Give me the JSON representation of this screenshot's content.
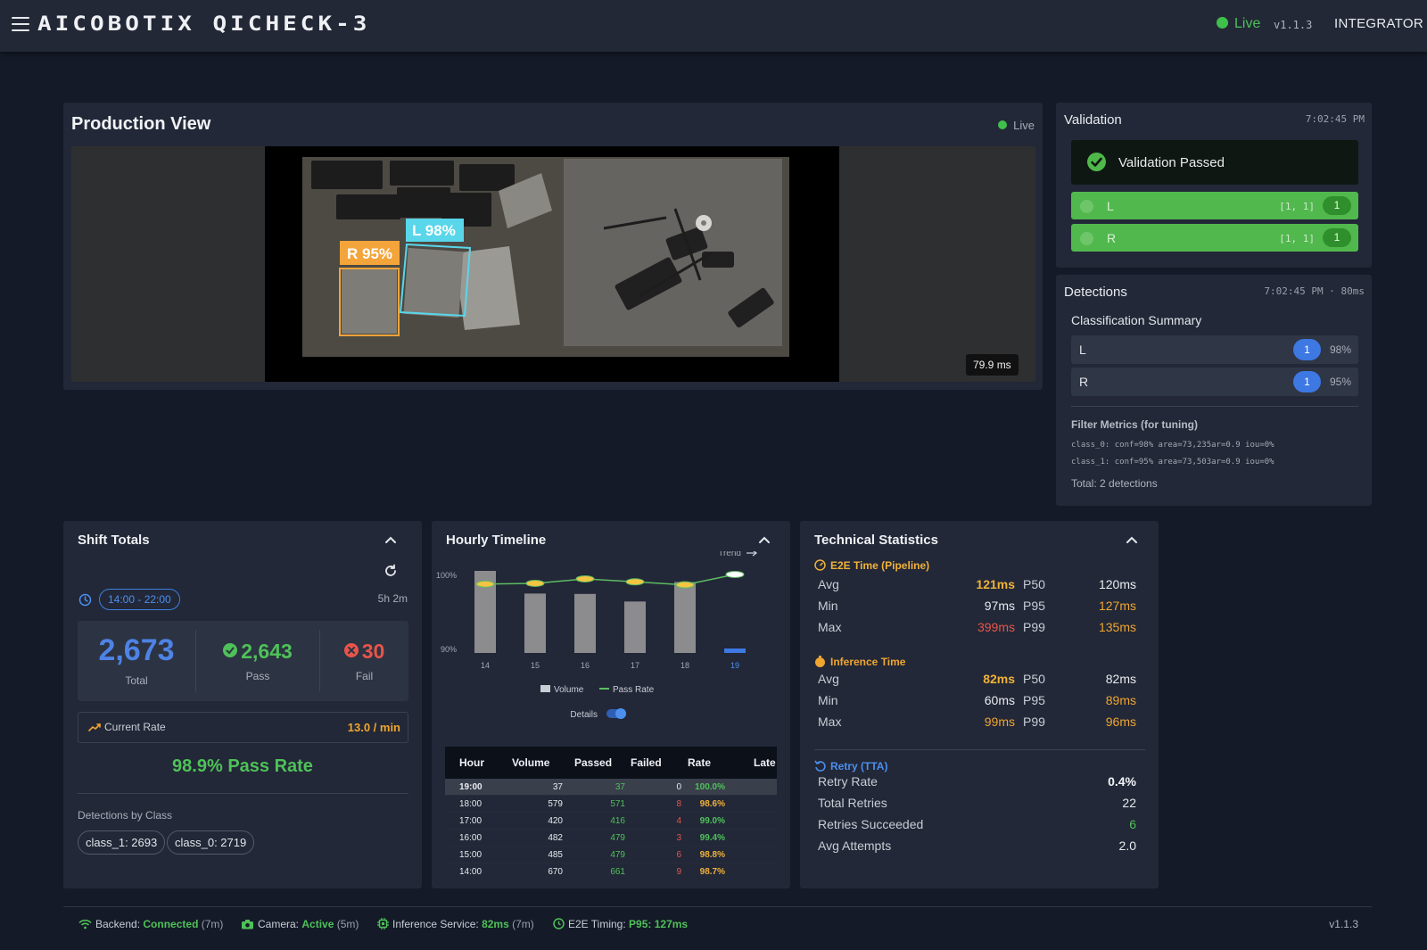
{
  "header": {
    "brand": "AICOBOTIX QICHECK-3",
    "status": "Live",
    "version": "v1.1.3",
    "role": "INTEGRATOR"
  },
  "production": {
    "title": "Production View",
    "live_label": "Live",
    "latency": "79.9 ms",
    "boxes": [
      {
        "label": "R 95%",
        "color": "#f3a43a"
      },
      {
        "label": "L 98%",
        "color": "#59d6ea"
      }
    ]
  },
  "validation": {
    "title": "Validation",
    "time": "7:02:45 PM",
    "status": "Validation Passed",
    "rows": [
      {
        "label": "L",
        "coords": "[1, 1]",
        "count": "1"
      },
      {
        "label": "R",
        "coords": "[1, 1]",
        "count": "1"
      }
    ]
  },
  "detections": {
    "title": "Detections",
    "time": "7:02:45 PM · 80ms",
    "summary_title": "Classification Summary",
    "classes": [
      {
        "label": "L",
        "count": "1",
        "pct": "98%"
      },
      {
        "label": "R",
        "count": "1",
        "pct": "95%"
      }
    ],
    "filter_title": "Filter Metrics (for tuning)",
    "filter_lines": [
      "class_0: conf=98% area=73,235ar=0.9 iou=0%",
      "class_1: conf=95% area=73,503ar=0.9 iou=0%"
    ],
    "total": "Total: 2 detections"
  },
  "shift": {
    "title": "Shift Totals",
    "range": "14:00 - 22:00",
    "duration": "5h 2m",
    "total": "2,673",
    "total_label": "Total",
    "pass": "2,643",
    "pass_label": "Pass",
    "fail": "30",
    "fail_label": "Fail",
    "rate_label": "Current Rate",
    "rate_value": "13.0 / min",
    "pass_rate": "98.9% Pass Rate",
    "by_class_label": "Detections by Class",
    "chips": [
      "class_1: 2693",
      "class_0: 2719"
    ]
  },
  "hourly": {
    "title": "Hourly Timeline",
    "trend_label": "Trend",
    "legend_volume": "Volume",
    "legend_passrate": "Pass Rate",
    "details_label": "Details",
    "details_on": true,
    "columns": [
      "Hour",
      "Volume",
      "Passed",
      "Failed",
      "Rate",
      "Late"
    ],
    "rows": [
      {
        "hour": "19:00",
        "volume": "37",
        "passed": "37",
        "failed": "0",
        "rate": "100.0%"
      },
      {
        "hour": "18:00",
        "volume": "579",
        "passed": "571",
        "failed": "8",
        "rate": "98.6%"
      },
      {
        "hour": "17:00",
        "volume": "420",
        "passed": "416",
        "failed": "4",
        "rate": "99.0%"
      },
      {
        "hour": "16:00",
        "volume": "482",
        "passed": "479",
        "failed": "3",
        "rate": "99.4%"
      },
      {
        "hour": "15:00",
        "volume": "485",
        "passed": "479",
        "failed": "6",
        "rate": "98.8%"
      },
      {
        "hour": "14:00",
        "volume": "670",
        "passed": "661",
        "failed": "9",
        "rate": "98.7%"
      }
    ]
  },
  "chart_data": {
    "type": "bar",
    "categories": [
      "14",
      "15",
      "16",
      "17",
      "18",
      "19"
    ],
    "highlight_category": "19",
    "series": [
      {
        "name": "Volume",
        "values": [
          670,
          485,
          482,
          420,
          579,
          37
        ]
      },
      {
        "name": "Pass Rate",
        "values": [
          98.7,
          98.8,
          99.4,
          99.0,
          98.6,
          100.0
        ]
      }
    ],
    "y_ticks": [
      "100%",
      "90%"
    ],
    "ylim": [
      90,
      100
    ],
    "legend": "bottom",
    "colors": {
      "volume": "#8c8c8f",
      "pass_rate": "#5dbb63",
      "marker": "#f2c542",
      "current": "#3d78e3"
    }
  },
  "tech": {
    "title": "Technical Statistics",
    "e2e_title": "E2E Time (Pipeline)",
    "e2e": [
      {
        "k": "Avg",
        "v": "121ms",
        "p": "P50",
        "pv": "120ms",
        "vc": "#f0b13a",
        "pc": "#e9ebef",
        "bold": true
      },
      {
        "k": "Min",
        "v": "97ms",
        "p": "P95",
        "pv": "127ms",
        "vc": "#e9ebef",
        "pc": "#f0a531",
        "bold": false
      },
      {
        "k": "Max",
        "v": "399ms",
        "p": "P99",
        "pv": "135ms",
        "vc": "#e8544a",
        "pc": "#f0a531",
        "bold": false
      }
    ],
    "inf_title": "Inference Time",
    "inf": [
      {
        "k": "Avg",
        "v": "82ms",
        "p": "P50",
        "pv": "82ms",
        "vc": "#f0b13a",
        "pc": "#e9ebef",
        "bold": true
      },
      {
        "k": "Min",
        "v": "60ms",
        "p": "P95",
        "pv": "89ms",
        "vc": "#e9ebef",
        "pc": "#f0a531",
        "bold": false
      },
      {
        "k": "Max",
        "v": "99ms",
        "p": "P99",
        "pv": "96ms",
        "vc": "#f0a531",
        "pc": "#f0a531",
        "bold": false
      }
    ],
    "retry_title": "Retry (TTA)",
    "retry": [
      {
        "k": "Retry Rate",
        "v": "0.4%",
        "vc": "#f1f3f7",
        "bold": true
      },
      {
        "k": "Total Retries",
        "v": "22",
        "vc": "#e9ebef",
        "bold": false
      },
      {
        "k": "Retries Succeeded",
        "v": "6",
        "vc": "#4fc159",
        "bold": false
      },
      {
        "k": "Avg Attempts",
        "v": "2.0",
        "vc": "#e9ebef",
        "bold": false
      }
    ]
  },
  "footer": {
    "backend_label": "Backend:",
    "backend_status": "Connected",
    "backend_age": "(7m)",
    "camera_label": "Camera:",
    "camera_status": "Active",
    "camera_age": "(5m)",
    "inference_label": "Inference Service:",
    "inference_value": "82ms",
    "inference_age": "(7m)",
    "e2e_label": "E2E Timing:",
    "e2e_value": "P95: 127ms",
    "version": "v1.1.3"
  }
}
